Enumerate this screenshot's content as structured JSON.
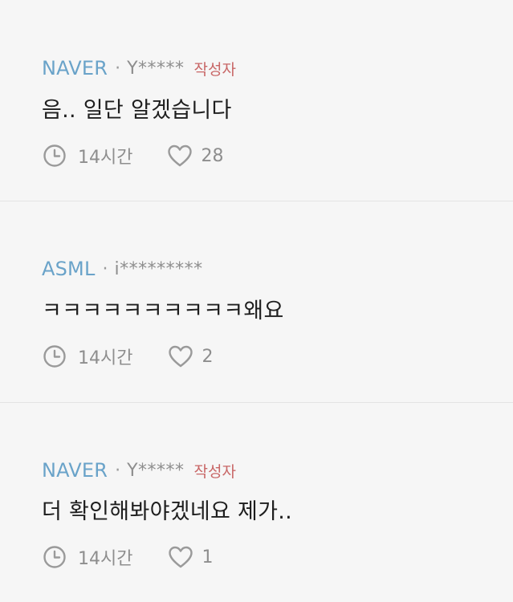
{
  "comments": [
    {
      "stock": "NAVER",
      "separator": "·",
      "user": "Y*****",
      "author_badge": "작성자",
      "text": "음.. 일단 알겠습니다",
      "time": "14시간",
      "likes": "28"
    },
    {
      "stock": "ASML",
      "separator": "·",
      "user": "i*********",
      "author_badge": "",
      "text": "ㅋㅋㅋㅋㅋㅋㅋㅋㅋㅋ왜요",
      "time": "14시간",
      "likes": "2"
    },
    {
      "stock": "NAVER",
      "separator": "·",
      "user": "Y*****",
      "author_badge": "작성자",
      "text": "더 확인해봐야겠네요 제가..",
      "time": "14시간",
      "likes": "1"
    }
  ],
  "icons": {
    "time": "clock-icon",
    "likes": "heart-icon"
  },
  "colors": {
    "stock_link": "#6aa3c9",
    "author_badge": "#c86666",
    "muted_text": "#8e8e8e",
    "body_text": "#1e1e1e",
    "background": "#f6f6f6"
  }
}
